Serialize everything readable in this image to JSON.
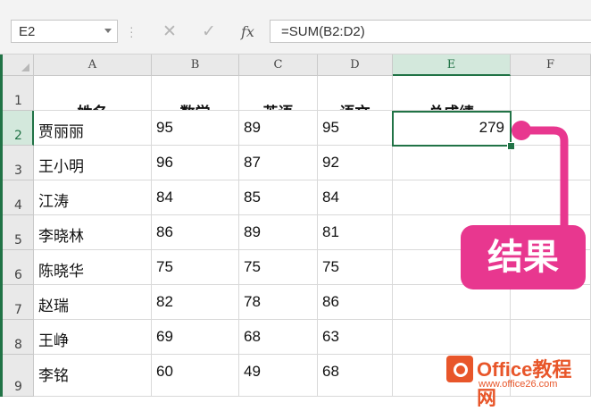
{
  "name_box": {
    "value": "E2"
  },
  "formula_bar": {
    "cancel_icon": "✕",
    "enter_icon": "✓",
    "fx_label": "fx",
    "formula": "=SUM(B2:D2)"
  },
  "columns": [
    "A",
    "B",
    "C",
    "D",
    "E",
    "F"
  ],
  "rows": [
    "1",
    "2",
    "3",
    "4",
    "5",
    "6",
    "7",
    "8",
    "9"
  ],
  "headers": [
    "姓名",
    "数学",
    "英语",
    "语文",
    "总成绩"
  ],
  "table": [
    [
      "贾丽丽",
      "95",
      "89",
      "95",
      "279"
    ],
    [
      "王小明",
      "96",
      "87",
      "92",
      ""
    ],
    [
      "江涛",
      "84",
      "85",
      "84",
      ""
    ],
    [
      "李晓林",
      "86",
      "89",
      "81",
      ""
    ],
    [
      "陈晓华",
      "75",
      "75",
      "75",
      ""
    ],
    [
      "赵瑞",
      "82",
      "78",
      "86",
      ""
    ],
    [
      "王峥",
      "69",
      "68",
      "63",
      ""
    ],
    [
      "李铭",
      "60",
      "49",
      "68",
      ""
    ]
  ],
  "callout": {
    "text": "结果",
    "color": "#e8378f"
  },
  "watermark": {
    "brand": "Office教程网",
    "url": "www.office26.com"
  },
  "colors": {
    "accent": "#217346",
    "header_bg": "#e9e9e9"
  },
  "selected_cell": "E2"
}
